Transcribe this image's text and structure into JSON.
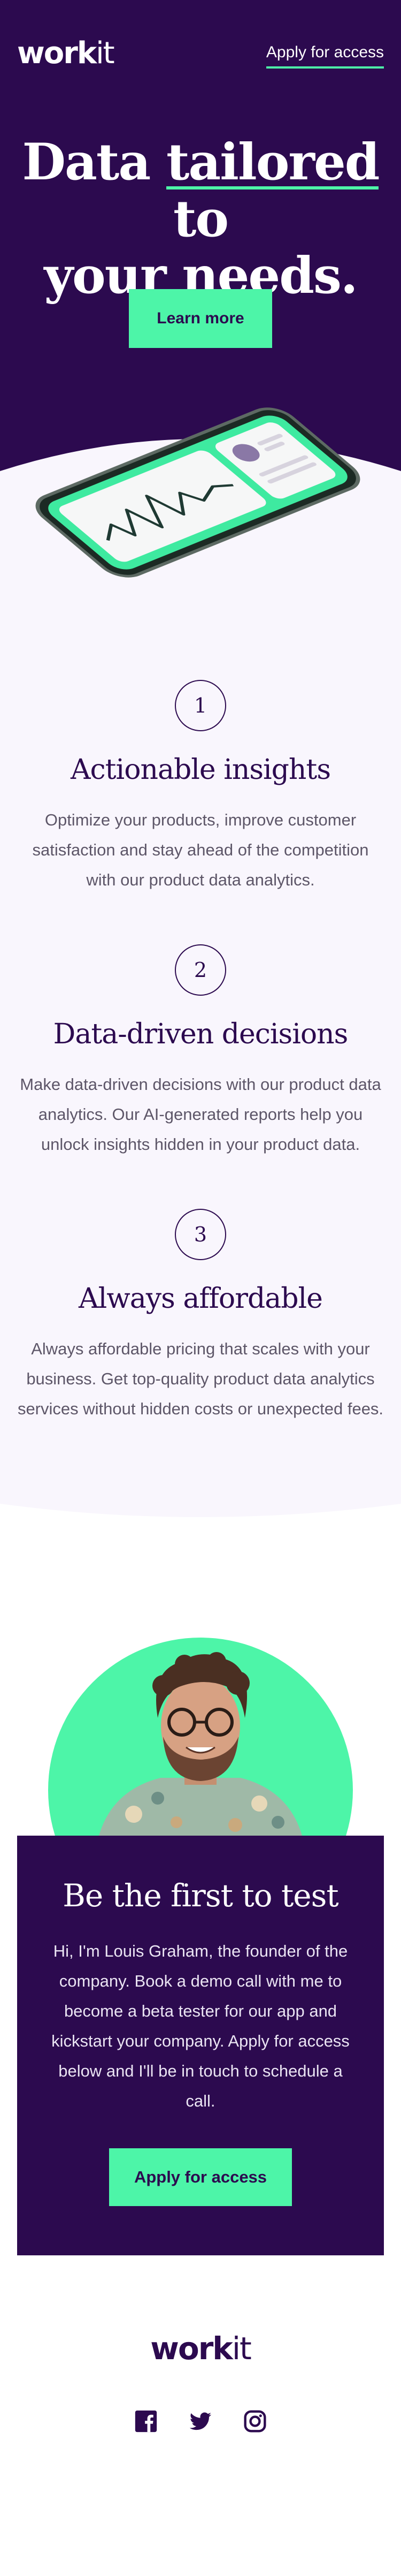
{
  "nav": {
    "logo_bold": "work",
    "logo_light": "it",
    "cta_label": "Apply for access"
  },
  "hero": {
    "title_line1_a": "Data ",
    "title_line1_u": "tailored",
    "title_line1_b": " to",
    "title_line2": "your needs.",
    "button_label": "Learn more"
  },
  "features": [
    {
      "number": "1",
      "title": "Actionable insights",
      "text": "Optimize your products, improve customer satisfaction and stay ahead of the competition with our product data analytics."
    },
    {
      "number": "2",
      "title": "Data-driven decisions",
      "text": "Make data-driven decisions with our product data analytics. Our AI-generated reports help you unlock insights hidden in your product data."
    },
    {
      "number": "3",
      "title": "Always affordable",
      "text": "Always affordable pricing that scales with your business. Get top-quality product data analytics services without hidden costs or unexpected fees."
    }
  ],
  "founder": {
    "title": "Be the first to test",
    "text": "Hi, I'm Louis Graham, the founder of the company. Book a demo call with me to become a beta tester for our app and kickstart your company. Apply for access below and I'll be in touch to schedule a call.",
    "button_label": "Apply for access"
  },
  "footer": {
    "logo_bold": "work",
    "logo_light": "it",
    "socials": [
      "facebook-icon",
      "twitter-icon",
      "instagram-icon"
    ]
  },
  "colors": {
    "primary": "#2c0a4f",
    "accent": "#4df5a8",
    "light_bg": "#f9f6fd",
    "body_text": "#5d5668"
  }
}
